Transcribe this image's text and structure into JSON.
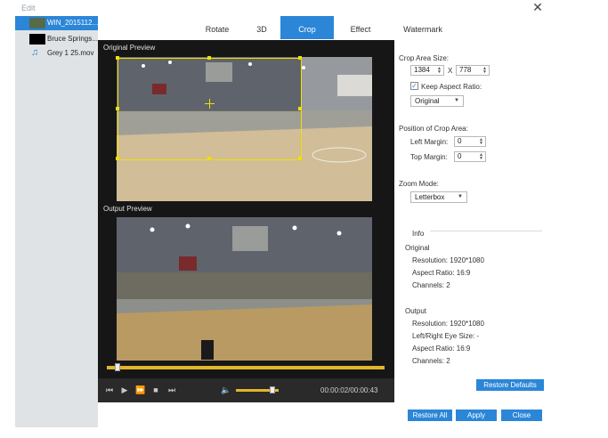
{
  "window": {
    "title": "Edit"
  },
  "files": [
    {
      "name": "WIN_2015112...",
      "selected": true
    },
    {
      "name": "Bruce Springs..."
    },
    {
      "name": "Grey 1 25.mov"
    }
  ],
  "tabs": [
    "Rotate",
    "3D",
    "Crop",
    "Effect",
    "Watermark"
  ],
  "active_tab": "Crop",
  "preview": {
    "original_label": "Original Preview",
    "output_label": "Output Preview",
    "timecode": "00:00:02/00:00:43",
    "progress": 0.03,
    "volume": 0.85
  },
  "crop": {
    "area_size_label": "Crop Area Size:",
    "width": "1384",
    "x_sep": "X",
    "height": "778",
    "keep_aspect_label": "Keep Aspect Ratio:",
    "keep_aspect_checked": "✓",
    "aspect_value": "Original",
    "position_label": "Position of Crop Area:",
    "left_margin_label": "Left Margin:",
    "left_margin": "0",
    "top_margin_label": "Top Margin:",
    "top_margin": "0",
    "zoom_label": "Zoom Mode:",
    "zoom_value": "Letterbox"
  },
  "info": {
    "heading": "Info",
    "original_heading": "Original",
    "orig_resolution": "Resolution: 1920*1080",
    "orig_aspect": "Aspect Ratio: 16:9",
    "orig_channels": "Channels: 2",
    "output_heading": "Output",
    "out_resolution": "Resolution: 1920*1080",
    "out_eye_size": "Left/Right Eye Size: -",
    "out_aspect": "Aspect Ratio: 16:9",
    "out_channels": "Channels: 2"
  },
  "buttons": {
    "restore_defaults": "Restore Defaults",
    "restore_all": "Restore All",
    "apply": "Apply",
    "close": "Close"
  },
  "colors": {
    "accent": "#2b86d8",
    "crop_border": "#f0e000",
    "timeline": "#e2b62a"
  }
}
